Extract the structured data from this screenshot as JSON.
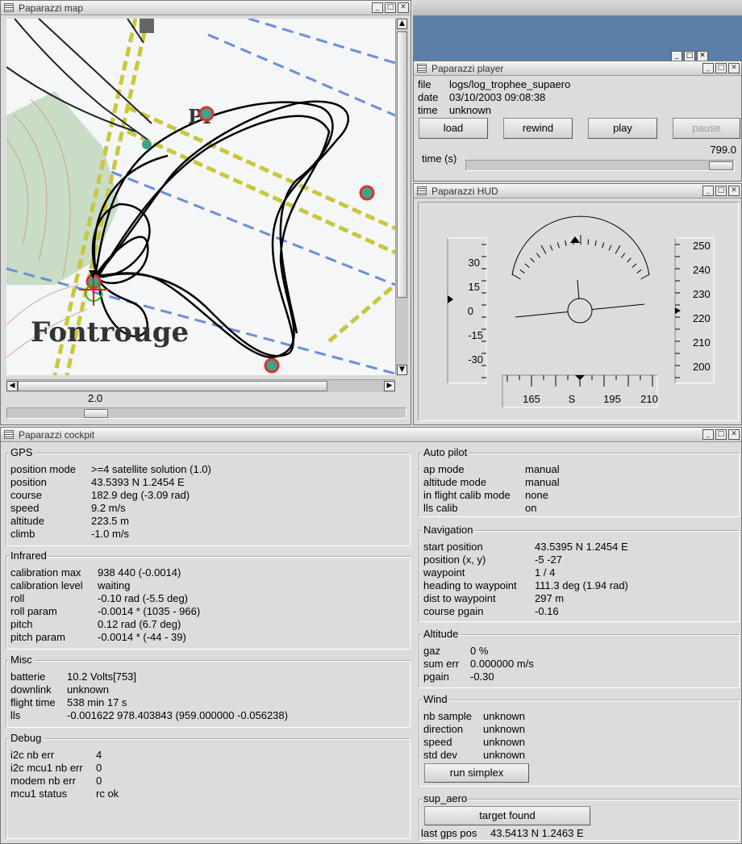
{
  "map": {
    "title": "Paparazzi map",
    "zoom": "2.0",
    "place_name": "Fontrouge",
    "place_fragment": "PI"
  },
  "player": {
    "title": "Paparazzi player",
    "file_key": "file",
    "file": "logs/log_trophee_supaero",
    "date_key": "date",
    "date": "03/10/2003 09:08:38",
    "time_key": "time",
    "time": "unknown",
    "load": "load",
    "rewind": "rewind",
    "play": "play",
    "pause": "pause",
    "time_value": "799.0",
    "time_label": "time (s)"
  },
  "hud": {
    "title": "Paparazzi HUD",
    "left_ticks": [
      "30",
      "15",
      "0",
      "-15",
      "-30"
    ],
    "right_ticks": [
      "250",
      "240",
      "230",
      "220",
      "210",
      "200"
    ],
    "compass_ticks": [
      "165",
      "S",
      "195",
      "210"
    ]
  },
  "cockpit": {
    "title": "Paparazzi cockpit",
    "gps": {
      "label": "GPS",
      "rows": [
        [
          "position mode",
          ">=4 satellite solution (1.0)"
        ],
        [
          "position",
          "43.5393 N 1.2454 E"
        ],
        [
          "course",
          "182.9 deg (-3.09 rad)"
        ],
        [
          "speed",
          "9.2 m/s"
        ],
        [
          "altitude",
          "223.5 m"
        ],
        [
          "climb",
          "-1.0 m/s"
        ]
      ]
    },
    "infrared": {
      "label": "Infrared",
      "rows": [
        [
          "calibration max",
          "938 440 (-0.0014)"
        ],
        [
          "calibration level",
          "waiting"
        ],
        [
          "roll",
          "-0.10 rad (-5.5 deg)"
        ],
        [
          "roll param",
          "-0.0014 * (1035 - 966)"
        ],
        [
          "pitch",
          "0.12 rad (6.7 deg)"
        ],
        [
          "pitch param",
          "-0.0014 * (-44 - 39)"
        ]
      ]
    },
    "misc": {
      "label": "Misc",
      "rows": [
        [
          "batterie",
          "10.2 Volts[753]"
        ],
        [
          "downlink",
          "unknown"
        ],
        [
          "flight time",
          "538 min 17 s"
        ],
        [
          "lls",
          "-0.001622 978.403843 (959.000000 -0.056238)"
        ]
      ]
    },
    "debug": {
      "label": "Debug",
      "rows": [
        [
          "i2c nb err",
          "4"
        ],
        [
          "i2c mcu1 nb err",
          "0"
        ],
        [
          "modem nb err",
          "0"
        ],
        [
          "mcu1 status",
          "rc ok"
        ]
      ]
    },
    "autopilot": {
      "label": "Auto pilot",
      "rows": [
        [
          "ap mode",
          "manual"
        ],
        [
          "altitude mode",
          "manual"
        ],
        [
          "in flight calib mode",
          "none"
        ],
        [
          "lls calib",
          "on"
        ]
      ]
    },
    "navigation": {
      "label": "Navigation",
      "rows": [
        [
          "start position",
          "43.5395 N 1.2454 E"
        ],
        [
          "position (x, y)",
          "-5 -27"
        ],
        [
          "waypoint",
          "1 / 4"
        ],
        [
          "heading to waypoint",
          "111.3 deg (1.94 rad)"
        ],
        [
          "dist to waypoint",
          "297 m"
        ],
        [
          "course pgain",
          "-0.16"
        ]
      ]
    },
    "altitude": {
      "label": "Altitude",
      "rows": [
        [
          "gaz",
          "0 %"
        ],
        [
          "sum err",
          "0.000000 m/s"
        ],
        [
          "pgain",
          "-0.30"
        ]
      ]
    },
    "wind": {
      "label": "Wind",
      "rows": [
        [
          "nb sample",
          "unknown"
        ],
        [
          "direction",
          "unknown"
        ],
        [
          "speed",
          "unknown"
        ],
        [
          "std dev",
          "unknown"
        ]
      ],
      "button": "run simplex"
    },
    "sup_aero": {
      "label": "sup_aero",
      "button": "target found",
      "last_key": "last gps pos",
      "last_val": "43.5413 N 1.2463 E"
    }
  },
  "colors": {
    "desktop": "#5a7fa8",
    "map_bg": "#f4f6f8",
    "track": "#000000",
    "waypoint": "#3aa58c"
  }
}
